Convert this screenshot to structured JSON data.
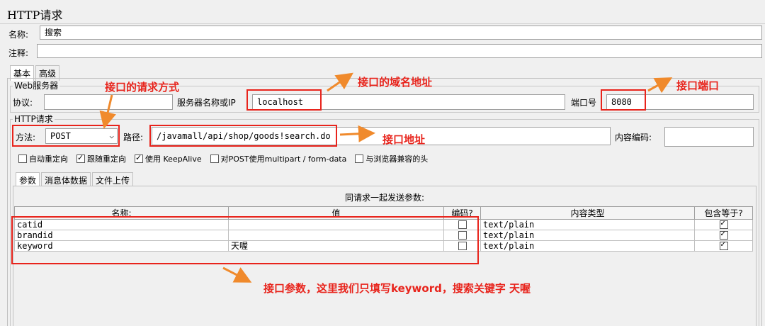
{
  "panel_title": "HTTP请求",
  "name_label": "名称:",
  "name_value": "搜索",
  "comment_label": "注释:",
  "comment_value": "",
  "tabs": [
    "基本",
    "高级"
  ],
  "web_server": {
    "legend": "Web服务器",
    "protocol_label": "协议:",
    "protocol_value": "",
    "server_label": "服务器名称或IP",
    "server_value": "localhost",
    "port_label": "端口号",
    "port_value": "8080"
  },
  "http_request": {
    "legend": "HTTP请求",
    "method_label": "方法:",
    "method_value": "POST",
    "path_label": "路径:",
    "path_value": "/javamall/api/shop/goods!search.do",
    "encoding_label": "内容编码:",
    "encoding_value": ""
  },
  "checkboxes": [
    {
      "label": "自动重定向",
      "checked": false
    },
    {
      "label": "跟随重定向",
      "checked": true
    },
    {
      "label": "使用 KeepAlive",
      "checked": true
    },
    {
      "label": "对POST使用multipart / form-data",
      "checked": false
    },
    {
      "label": "与浏览器兼容的头",
      "checked": false
    }
  ],
  "sub_tabs": [
    "参数",
    "消息体数据",
    "文件上传"
  ],
  "params_caption": "同请求一起发送参数:",
  "param_columns": [
    "名称:",
    "值",
    "编码?",
    "内容类型",
    "包含等于?"
  ],
  "params": [
    {
      "name": "catid",
      "value": "",
      "encode": false,
      "content_type": "text/plain",
      "include_equals": true
    },
    {
      "name": "brandid",
      "value": "",
      "encode": false,
      "content_type": "text/plain",
      "include_equals": true
    },
    {
      "name": "keyword",
      "value": "天喔",
      "encode": false,
      "content_type": "text/plain",
      "include_equals": true
    }
  ],
  "annotations": {
    "method": "接口的请求方式",
    "domain": "接口的域名地址",
    "port": "接口端口",
    "path": "接口地址",
    "params": "接口参数，这里我们只填写keyword，搜索关键字 天喔"
  },
  "colors": {
    "annotation": "#e8241c",
    "arrow": "#f08a2c"
  }
}
